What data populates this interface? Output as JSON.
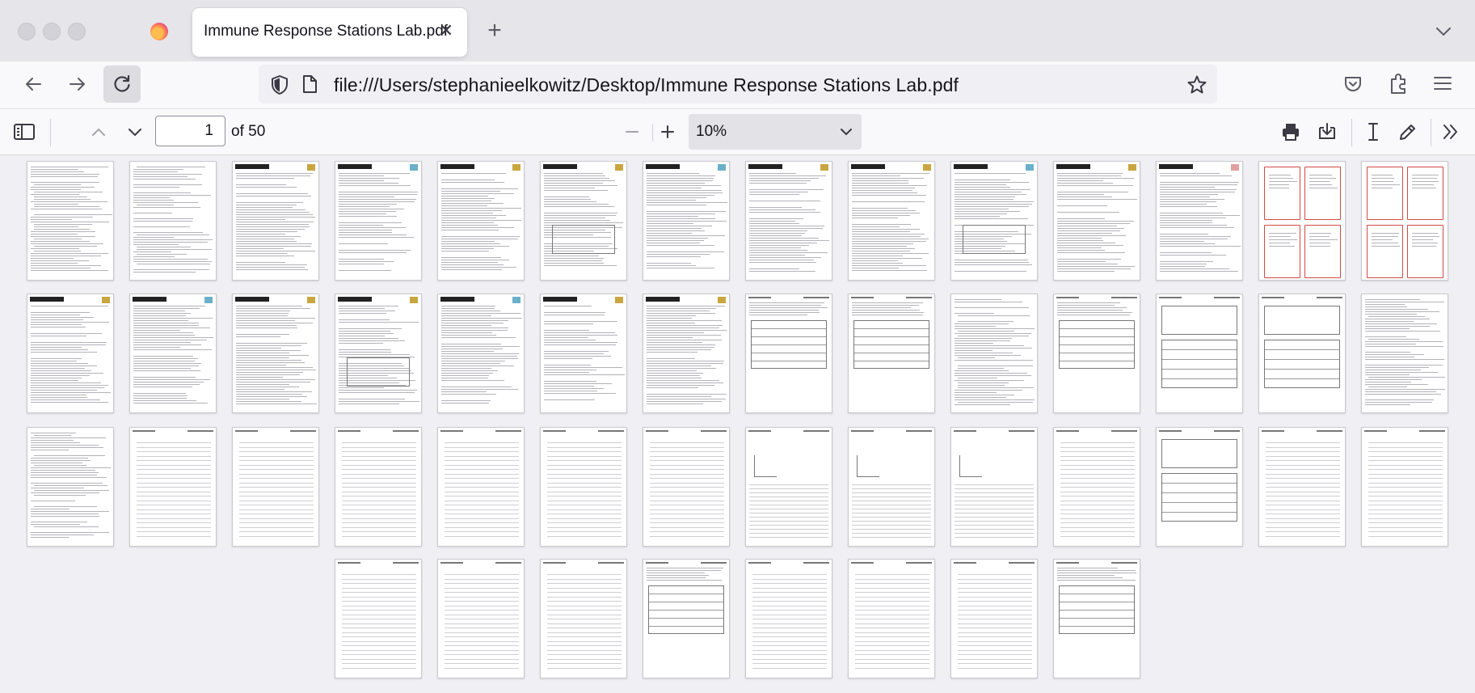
{
  "browser": {
    "tab_title": "Immune Response Stations Lab.pdf",
    "tab_close": "✕",
    "new_tab": "+",
    "url": "file:///Users/stephanieelkowitz/Desktop/Immune Response Stations Lab.pdf"
  },
  "pdf_toolbar": {
    "page_number": "1",
    "page_count": "of 50",
    "zoom": "10%",
    "zoom_minus": "—",
    "zoom_plus": "+"
  },
  "icons": {
    "sidebar": "sidebar-toggle-icon",
    "prev": "chevron-up-icon",
    "next": "chevron-down-icon",
    "print": "printer-icon",
    "save": "download-icon",
    "text": "text-cursor-icon",
    "draw": "pen-icon",
    "more": "double-chevron-icon"
  },
  "colors": {
    "accent_red": "#d24a44",
    "toolbar_bg": "#f9f9fb",
    "tab_strip_bg": "#e6e5ea"
  }
}
